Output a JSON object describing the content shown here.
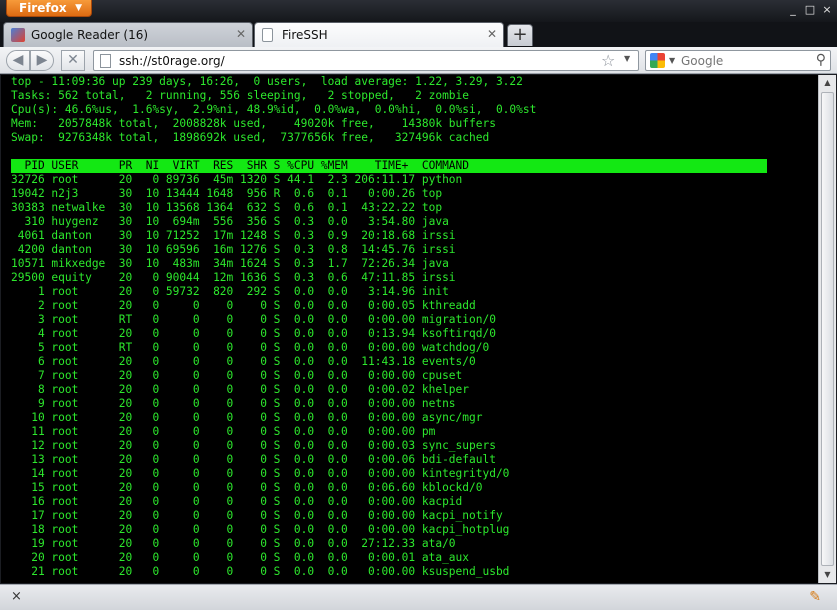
{
  "browser": {
    "app_button": "Firefox",
    "window_controls": [
      "_",
      "□",
      "×"
    ]
  },
  "tabs": [
    {
      "label": "Google Reader (16)",
      "icon": "google-reader-icon",
      "active": false
    },
    {
      "label": "FireSSH",
      "icon": "page-icon",
      "active": true
    }
  ],
  "navbar": {
    "url": "ssh://st0rage.org/",
    "search_placeholder": "Google"
  },
  "terminal": {
    "summary": [
      "top - 11:09:36 up 239 days, 16:26,  0 users,  load average: 1.22, 3.29, 3.22",
      "Tasks: 562 total,   2 running, 556 sleeping,   2 stopped,   2 zombie",
      "Cpu(s): 46.6%us,  1.6%sy,  2.9%ni, 48.9%id,  0.0%wa,  0.0%hi,  0.0%si,  0.0%st",
      "Mem:   2057848k total,  2008828k used,    49020k free,    14380k buffers",
      "Swap:  9276348k total,  1898692k used,  7377656k free,   327496k cached"
    ],
    "header": "  PID USER      PR  NI  VIRT  RES  SHR S %CPU %MEM    TIME+  COMMAND",
    "rows": [
      "32726 root      20   0 89736  45m 1320 S 44.1  2.3 206:11.17 python",
      "19042 n2j3      30  10 13444 1648  956 R  0.6  0.1   0:00.26 top",
      "30383 netwalke  30  10 13568 1364  632 S  0.6  0.1  43:22.22 top",
      "  310 huygenz   30  10  694m  556  356 S  0.3  0.0   3:54.80 java",
      " 4061 danton    30  10 71252  17m 1248 S  0.3  0.9  20:18.68 irssi",
      " 4200 danton    30  10 69596  16m 1276 S  0.3  0.8  14:45.76 irssi",
      "10571 mikxedge  30  10  483m  34m 1624 S  0.3  1.7  72:26.34 java",
      "29500 equity    20   0 90044  12m 1636 S  0.3  0.6  47:11.85 irssi",
      "    1 root      20   0 59732  820  292 S  0.0  0.0   3:14.96 init",
      "    2 root      20   0     0    0    0 S  0.0  0.0   0:00.05 kthreadd",
      "    3 root      RT   0     0    0    0 S  0.0  0.0   0:00.00 migration/0",
      "    4 root      20   0     0    0    0 S  0.0  0.0   0:13.94 ksoftirqd/0",
      "    5 root      RT   0     0    0    0 S  0.0  0.0   0:00.00 watchdog/0",
      "    6 root      20   0     0    0    0 S  0.0  0.0  11:43.18 events/0",
      "    7 root      20   0     0    0    0 S  0.0  0.0   0:00.00 cpuset",
      "    8 root      20   0     0    0    0 S  0.0  0.0   0:00.02 khelper",
      "    9 root      20   0     0    0    0 S  0.0  0.0   0:00.00 netns",
      "   10 root      20   0     0    0    0 S  0.0  0.0   0:00.00 async/mgr",
      "   11 root      20   0     0    0    0 S  0.0  0.0   0:00.00 pm",
      "   12 root      20   0     0    0    0 S  0.0  0.0   0:00.03 sync_supers",
      "   13 root      20   0     0    0    0 S  0.0  0.0   0:00.06 bdi-default",
      "   14 root      20   0     0    0    0 S  0.0  0.0   0:00.00 kintegrityd/0",
      "   15 root      20   0     0    0    0 S  0.0  0.0   0:06.60 kblockd/0",
      "   16 root      20   0     0    0    0 S  0.0  0.0   0:00.00 kacpid",
      "   17 root      20   0     0    0    0 S  0.0  0.0   0:00.00 kacpi_notify",
      "   18 root      20   0     0    0    0 S  0.0  0.0   0:00.00 kacpi_hotplug",
      "   19 root      20   0     0    0    0 S  0.0  0.0  27:12.33 ata/0",
      "   20 root      20   0     0    0    0 S  0.0  0.0   0:00.01 ata_aux",
      "   21 root      20   0     0    0    0 S  0.0  0.0   0:00.00 ksuspend_usbd"
    ]
  },
  "statusbar": {
    "close_glyph": "×"
  },
  "colors": {
    "terminal_bg": "#000000",
    "terminal_fg": "#2de82d",
    "header_bg": "#13e813",
    "firefox_orange": "#e8781f"
  }
}
